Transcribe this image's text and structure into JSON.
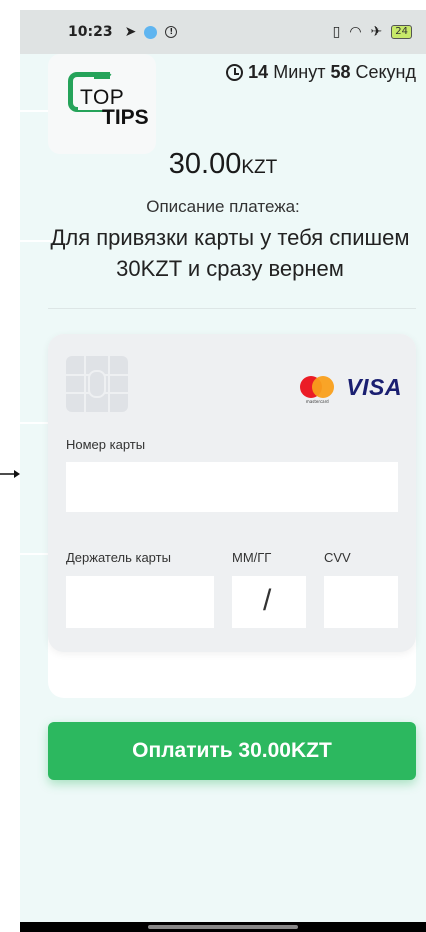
{
  "status_bar": {
    "time": "10:23",
    "battery": "24"
  },
  "logo": {
    "line1": "TOP",
    "line2": "TIPS"
  },
  "timer": {
    "minutes": "14",
    "minutes_label": "Минут",
    "seconds": "58",
    "seconds_label": "Секунд"
  },
  "payment": {
    "amount": "30.00",
    "currency": "KZT",
    "description_title": "Описание платежа:",
    "description_text": "Для привязки карты у тебя спишем 30KZT и сразу вернем"
  },
  "card_form": {
    "brand_mastercard_text": "mastercard",
    "brand_visa": "VISA",
    "card_number_label": "Номер карты",
    "card_number_value": "",
    "holder_label": "Держатель карты",
    "holder_value": "",
    "expiry_label": "ММ/ГГ",
    "expiry_separator": "/",
    "cvv_label": "CVV",
    "cvv_value": ""
  },
  "pay_button": {
    "label": "Оплатить 30.00KZT"
  },
  "colors": {
    "brand_green": "#2cb85f",
    "background": "#eef9f8",
    "visa_blue": "#1a1f71"
  }
}
